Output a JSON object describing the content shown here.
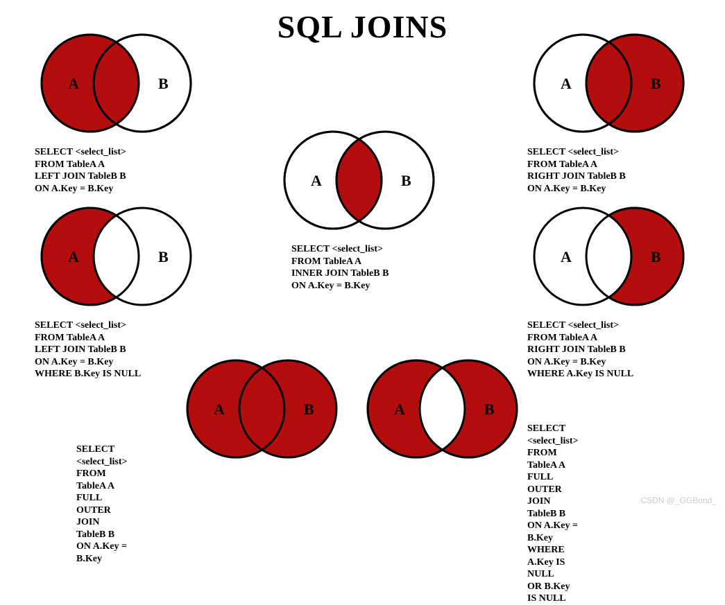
{
  "title": "SQL JOINS",
  "labels": {
    "A": "A",
    "B": "B"
  },
  "colors": {
    "fill": "#B40D0D",
    "stroke": "#000"
  },
  "joins": {
    "left": {
      "type": "LEFT JOIN (all A)",
      "sql": "SELECT <select_list>\nFROM TableA A\nLEFT JOIN TableB B\nON A.Key = B.Key"
    },
    "right": {
      "type": "RIGHT JOIN (all B)",
      "sql": "SELECT <select_list>\nFROM TableA A\nRIGHT JOIN TableB B\nON A.Key = B.Key"
    },
    "inner": {
      "type": "INNER JOIN (intersection only)",
      "sql": "SELECT <select_list>\nFROM TableA A\nINNER JOIN TableB B\nON A.Key = B.Key"
    },
    "left_excl": {
      "type": "LEFT JOIN excluding intersection",
      "sql": "SELECT <select_list>\nFROM TableA A\nLEFT JOIN TableB B\nON A.Key = B.Key\nWHERE B.Key IS NULL"
    },
    "right_excl": {
      "type": "RIGHT JOIN excluding intersection",
      "sql": "SELECT <select_list>\nFROM TableA A\nRIGHT JOIN TableB B\nON A.Key = B.Key\nWHERE A.Key IS NULL"
    },
    "full": {
      "type": "FULL OUTER JOIN (all A and B)",
      "sql": "SELECT <select_list>\nFROM TableA A\nFULL OUTER JOIN TableB B\nON A.Key = B.Key"
    },
    "full_excl": {
      "type": "FULL OUTER JOIN excluding intersection",
      "sql": "SELECT <select_list>\nFROM TableA A\nFULL OUTER JOIN TableB B\nON A.Key = B.Key\nWHERE A.Key IS NULL\nOR B.Key IS NULL"
    }
  },
  "watermark": "CSDN @_GGBond_"
}
